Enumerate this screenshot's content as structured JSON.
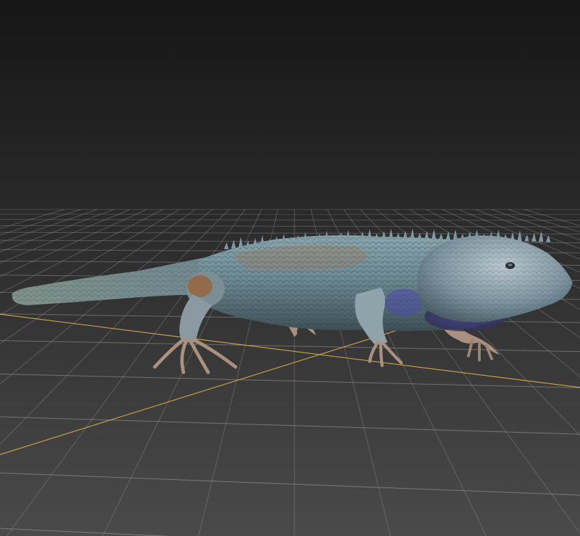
{
  "viewport": {
    "background_top": "#161616",
    "background_bottom": "#4a4a4a",
    "grid_color": "#8c8c8c",
    "axis_color": "#c9a24a"
  },
  "model": {
    "body_color": "#6d8a94",
    "belly_color": "#4a3f8c",
    "limb_color": "#a9907f",
    "spine_color": "#7f9aa3"
  }
}
